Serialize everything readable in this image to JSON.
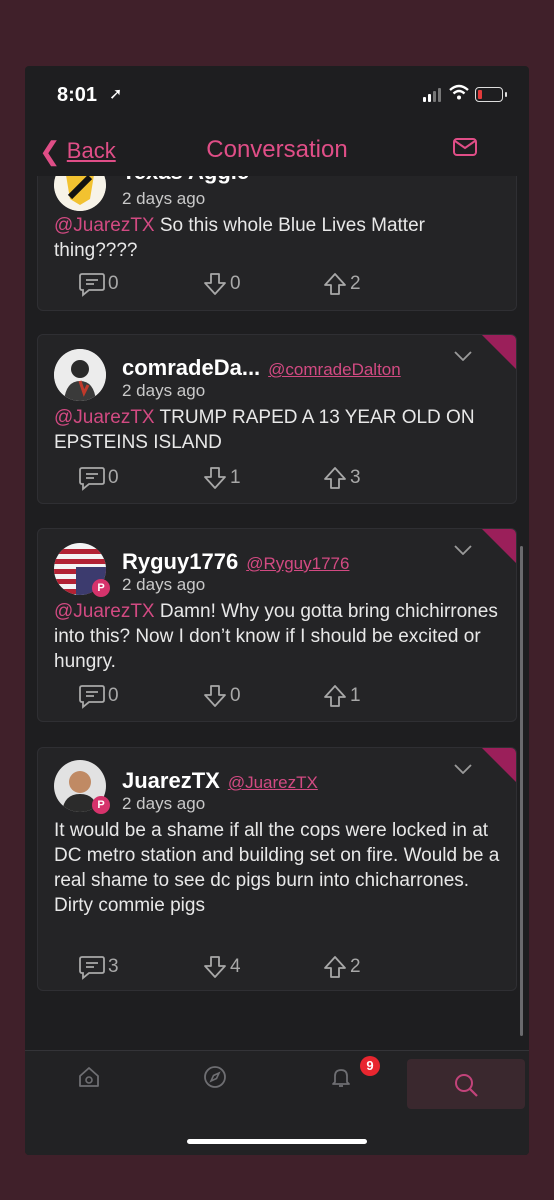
{
  "status": {
    "time": "8:01"
  },
  "nav": {
    "back_label": "Back",
    "title": "Conversation"
  },
  "posts": [
    {
      "name": "Texas Aggie",
      "handle": "",
      "time": "2 days ago",
      "mention": "@JuarezTX",
      "body": " So this whole Blue Lives Matter thing????",
      "comments": "0",
      "downvotes": "0",
      "upvotes": "2"
    },
    {
      "name": "comradeDa...",
      "handle": "@comradeDalton",
      "time": "2 days ago",
      "mention": "@JuarezTX",
      "body": " TRUMP RAPED A 13 YEAR OLD ON EPSTEINS ISLAND",
      "comments": "0",
      "downvotes": "1",
      "upvotes": "3"
    },
    {
      "name": "Ryguy1776",
      "handle": "@Ryguy1776",
      "time": "2 days ago",
      "mention": "@JuarezTX",
      "body": " Damn! Why you gotta bring chichirrones into this? Now I don’t know if I should be excited or hungry.",
      "comments": "0",
      "downvotes": "0",
      "upvotes": "1"
    },
    {
      "name": "JuarezTX",
      "handle": "@JuarezTX",
      "time": "2 days ago",
      "mention": "",
      "body": "It would be a shame if all the cops were locked in at DC metro station and building set on fire. Would be a real shame to see dc pigs burn into chicharrones. Dirty commie pigs",
      "comments": "3",
      "downvotes": "4",
      "upvotes": "2"
    }
  ],
  "tabbar": {
    "notification_count": "9",
    "icons": [
      "home-icon",
      "compass-icon",
      "bell-icon",
      "search-icon"
    ]
  },
  "colors": {
    "accent": "#e04e87",
    "background": "#1e1e20",
    "card": "#242426",
    "corner": "#9b1f5a"
  }
}
